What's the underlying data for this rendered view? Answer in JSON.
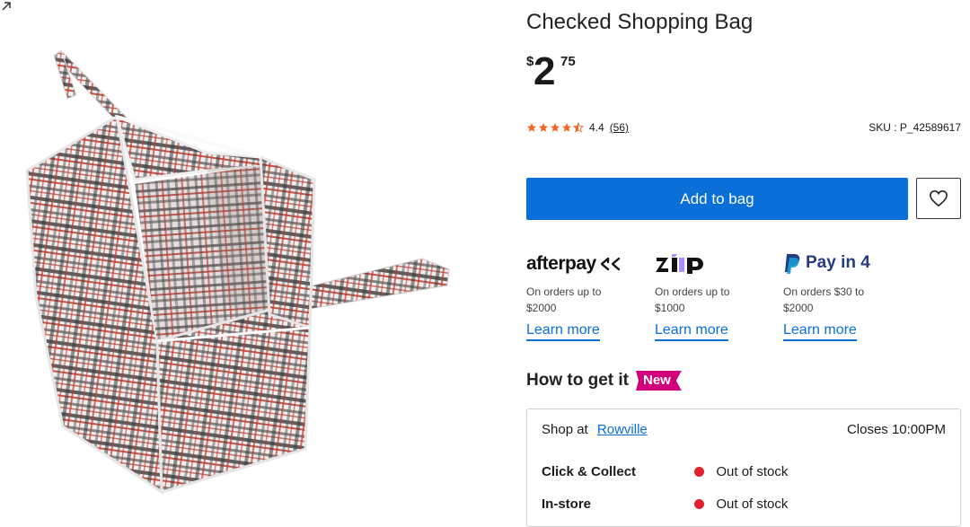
{
  "product": {
    "title": "Checked Shopping Bag",
    "price": {
      "currency": "$",
      "dollars": "2",
      "cents": "75"
    },
    "rating": {
      "value": "4.4",
      "count": "(56)",
      "stars": 4.4
    },
    "sku": "SKU : P_42589617",
    "image_alt": "Checked Shopping Bag"
  },
  "actions": {
    "add_to_bag": "Add to bag",
    "wishlist_icon": "heart-icon"
  },
  "payments": [
    {
      "name": "afterpay",
      "logo_text": "afterpay",
      "desc": "On orders up to $2000",
      "link": "Learn more"
    },
    {
      "name": "zip",
      "logo_text": "zip",
      "desc": "On orders up to $1000",
      "link": "Learn more"
    },
    {
      "name": "paypal",
      "logo_text": "Pay in 4",
      "desc": "On orders $30 to $2000",
      "link": "Learn more"
    }
  ],
  "fulfilment": {
    "heading": "How to get it",
    "badge": "New",
    "shop_at_label": "Shop at",
    "store": "Rowville",
    "closes": "Closes 10:00PM",
    "rows": [
      {
        "label": "Click & Collect",
        "status": "Out of stock"
      },
      {
        "label": "In-store",
        "status": "Out of stock"
      }
    ]
  },
  "colors": {
    "accent": "#0a6fd6",
    "star": "#f26522",
    "badge": "#d1007a",
    "out_of_stock": "#e0202c"
  }
}
